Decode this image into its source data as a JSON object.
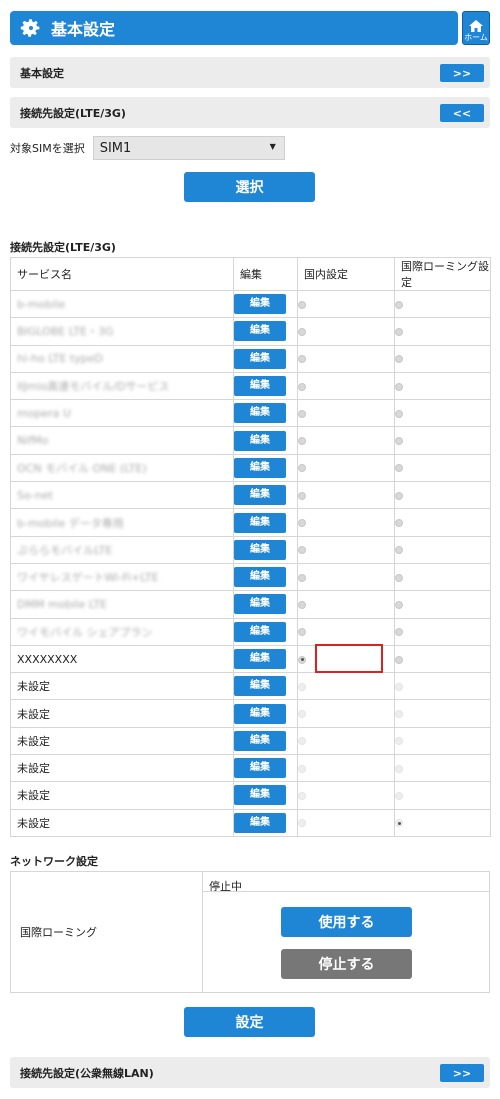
{
  "header": {
    "title": "基本設定",
    "home_label": "ホーム"
  },
  "sections": {
    "basic": {
      "title": "基本設定",
      "toggle": ">>"
    },
    "lte": {
      "title": "接続先設定(LTE/3G)",
      "toggle": "<<"
    },
    "wlan": {
      "title": "接続先設定(公衆無線LAN)",
      "toggle": ">>"
    }
  },
  "sim": {
    "label": "対象SIMを選択",
    "value": "SIM1"
  },
  "buttons": {
    "select": "選択",
    "apply": "設定",
    "use": "使用する",
    "stop": "停止する"
  },
  "connection_table": {
    "heading": "接続先設定(LTE/3G)",
    "columns": [
      "サービス名",
      "編集",
      "国内設定",
      "国際ローミング設定"
    ],
    "edit_label": "編集",
    "rows": [
      {
        "name": "b-mobile",
        "blurred": true,
        "domestic": false,
        "intl": false
      },
      {
        "name": "BIGLOBE LTE・3G",
        "blurred": true,
        "domestic": false,
        "intl": false
      },
      {
        "name": "hi-ho LTE typeD",
        "blurred": true,
        "domestic": false,
        "intl": false
      },
      {
        "name": "IIJmio高速モバイル/Dサービス",
        "blurred": true,
        "domestic": false,
        "intl": false
      },
      {
        "name": "mopera U",
        "blurred": true,
        "domestic": false,
        "intl": false
      },
      {
        "name": "NifMo",
        "blurred": true,
        "domestic": false,
        "intl": false
      },
      {
        "name": "OCN モバイル ONE (LTE)",
        "blurred": true,
        "domestic": false,
        "intl": false
      },
      {
        "name": "So-net",
        "blurred": true,
        "domestic": false,
        "intl": false
      },
      {
        "name": "b-mobile データ専用",
        "blurred": true,
        "domestic": false,
        "intl": false
      },
      {
        "name": "ぷららモバイルLTE",
        "blurred": true,
        "domestic": false,
        "intl": false
      },
      {
        "name": "ワイヤレスゲートWi-Fi+LTE",
        "blurred": true,
        "domestic": false,
        "intl": false
      },
      {
        "name": "DMM mobile LTE",
        "blurred": true,
        "domestic": false,
        "intl": false
      },
      {
        "name": "ワイモバイル シェアプラン",
        "blurred": true,
        "domestic": false,
        "intl": false
      },
      {
        "name": "XXXXXXXX",
        "blurred": false,
        "domestic": true,
        "intl": false
      },
      {
        "name": "未設定",
        "blurred": false,
        "domestic": false,
        "intl": false,
        "faint": true
      },
      {
        "name": "未設定",
        "blurred": false,
        "domestic": false,
        "intl": false,
        "faint": true
      },
      {
        "name": "未設定",
        "blurred": false,
        "domestic": false,
        "intl": false,
        "faint": true
      },
      {
        "name": "未設定",
        "blurred": false,
        "domestic": false,
        "intl": false,
        "faint": true
      },
      {
        "name": "未設定",
        "blurred": false,
        "domestic": false,
        "intl": false,
        "faint": true
      },
      {
        "name": "未設定",
        "blurred": false,
        "domestic": false,
        "intl": true,
        "faint": true
      }
    ]
  },
  "network": {
    "heading": "ネットワーク設定",
    "roaming_label": "国際ローミング",
    "status": "停止中"
  },
  "colors": {
    "primary": "#1f86d6",
    "section_bg": "#ececec",
    "stop_button": "#777777",
    "highlight": "#e02020"
  },
  "icons": {
    "title": "gear-icon",
    "home": "home-icon"
  }
}
